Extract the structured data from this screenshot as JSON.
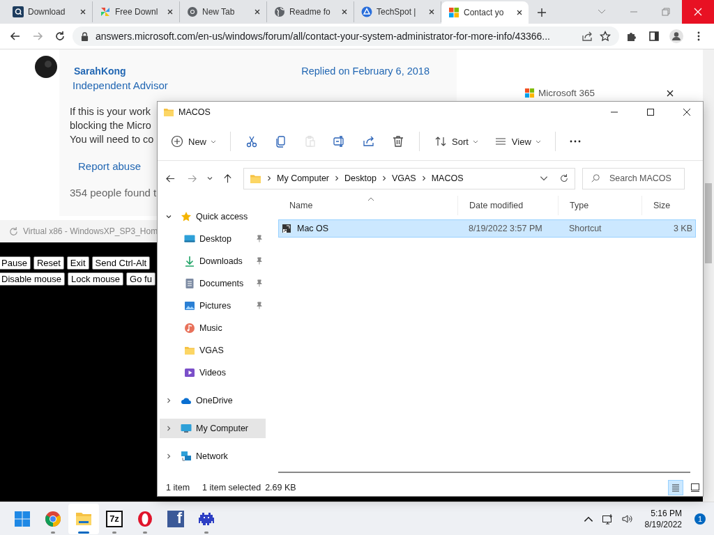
{
  "browser": {
    "tabs": [
      {
        "title": "Download",
        "kind": "magnifier",
        "selected": false
      },
      {
        "title": "Free Downl",
        "kind": "pinwheel",
        "selected": false
      },
      {
        "title": "New Tab",
        "kind": "wheel",
        "selected": false
      },
      {
        "title": "Readme fo",
        "kind": "globe",
        "selected": false
      },
      {
        "title": "TechSpot |",
        "kind": "triangle",
        "selected": false
      },
      {
        "title": "Contact yo",
        "kind": "squares",
        "selected": true
      }
    ],
    "url": "answers.microsoft.com/en-us/windows/forum/all/contact-your-system-administrator-for-more-info/43366..."
  },
  "page": {
    "author": "SarahKong",
    "role": "Independent Advisor",
    "date": "Replied on February 6, 2018",
    "lines": [
      "If this is your work",
      "blocking the Micro",
      "You will need to co"
    ],
    "report": "Report abuse",
    "helpful": "354 people found t",
    "banner": "Microsoft 365"
  },
  "emulator": {
    "title": "Virtual x86 - WindowsXP_SP3_Hom",
    "controls": [
      "Pause",
      "Reset",
      "Exit",
      "Send Ctrl-Alt"
    ],
    "mouse_controls": [
      "Disable mouse",
      "Lock mouse",
      "Go fu"
    ]
  },
  "explorer": {
    "title": "MACOS",
    "new": "New",
    "sort": "Sort",
    "view": "View",
    "tools": [
      {
        "kind": "cut",
        "disabled": false
      },
      {
        "kind": "copy",
        "disabled": false
      },
      {
        "kind": "paste",
        "disabled": true
      },
      {
        "kind": "rename",
        "disabled": false
      },
      {
        "kind": "share",
        "disabled": false
      },
      {
        "kind": "delete",
        "disabled": false
      }
    ],
    "path": [
      "My Computer",
      "Desktop",
      "VGAS",
      "MACOS"
    ],
    "search": {
      "placeholder": "Search MACOS"
    },
    "nav": [
      {
        "label": "Quick access",
        "kind": "star",
        "expanded": true,
        "selected": false,
        "children": [
          {
            "label": "Desktop",
            "kind": "desktop",
            "pinned": true,
            "selected": false
          },
          {
            "label": "Downloads",
            "kind": "download",
            "pinned": true,
            "selected": false
          },
          {
            "label": "Documents",
            "kind": "document",
            "pinned": true,
            "selected": false
          },
          {
            "label": "Pictures",
            "kind": "pictures",
            "pinned": true,
            "selected": false
          },
          {
            "label": "Music",
            "kind": "music",
            "pinned": false,
            "selected": false
          },
          {
            "label": "VGAS",
            "kind": "folder",
            "pinned": false,
            "selected": false
          },
          {
            "label": "Videos",
            "kind": "video",
            "pinned": false,
            "selected": false
          }
        ]
      },
      {
        "label": "OneDrive",
        "kind": "cloud",
        "expanded": false,
        "selected": false
      },
      {
        "label": "My Computer",
        "kind": "computer",
        "expanded": false,
        "selected": true
      },
      {
        "label": "Network",
        "kind": "network",
        "expanded": false,
        "selected": false
      }
    ],
    "columns": [
      "Name",
      "Date modified",
      "Type",
      "Size"
    ],
    "rows": [
      {
        "name": "Mac OS",
        "date": "8/19/2022 3:57 PM",
        "type": "Shortcut",
        "size": "3 KB",
        "selected": true
      }
    ],
    "status": {
      "count": "1 item",
      "selection": "1 item selected",
      "size": "2.69 KB"
    },
    "views": [
      {
        "kind": "details",
        "selected": true
      },
      {
        "kind": "tiles",
        "selected": false
      }
    ]
  },
  "taskbar": {
    "apps": [
      {
        "kind": "start",
        "running": false,
        "selected": false
      },
      {
        "kind": "wheel",
        "running": true,
        "selected": false
      },
      {
        "kind": "folder",
        "running": true,
        "selected": true
      },
      {
        "kind": "archive",
        "glyph": "7z",
        "running": true,
        "selected": false
      },
      {
        "kind": "ring",
        "running": true,
        "selected": false
      },
      {
        "kind": "square",
        "glyph": "f",
        "running": false,
        "selected": false
      },
      {
        "kind": "invader",
        "running": true,
        "selected": false
      }
    ],
    "time": "5:16 PM",
    "date": "8/19/2022",
    "notifications": "1"
  }
}
